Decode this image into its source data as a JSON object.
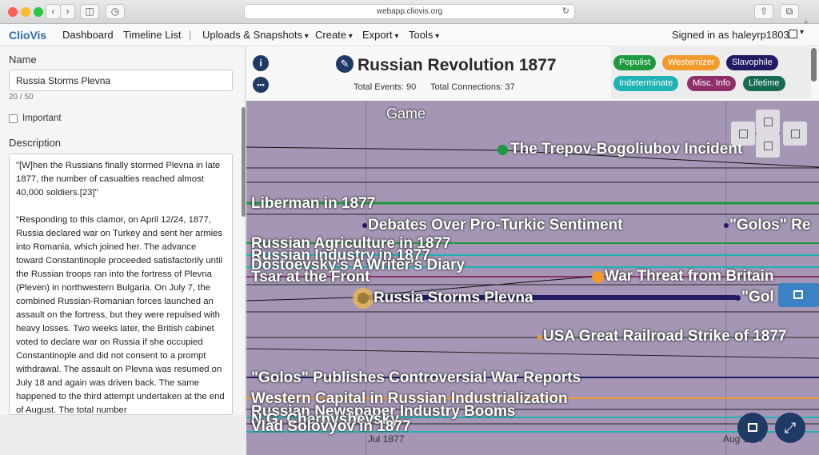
{
  "browser": {
    "url": "webapp.cliovis.org"
  },
  "nav": {
    "brand": "ClioVis",
    "dashboard": "Dashboard",
    "timeline_list": "Timeline List",
    "separator": "|",
    "uploads": "Uploads & Snapshots",
    "create": "Create",
    "export": "Export",
    "tools": "Tools",
    "signed_in": "Signed in as haleyrp1803"
  },
  "editor": {
    "name_label": "Name",
    "name_value": "Russia Storms Plevna",
    "name_counter": "20 / 50",
    "important_label": "Important",
    "description_label": "Description",
    "description": "\"[W]hen the Russians finally stormed Plevna in late 1877, the number of casualties reached almost 40,000 soldiers.[23]\"\n\n\"Responding to this clamor, on April 12/24, 1877, Russia declared war on Turkey and sent her armies into Romania, which joined her. The advance toward Constantinople proceeded satisfactorily until the Russian troops ran into the fortress of Plevna (Pleven) in northwestern Bulgaria. On July 7, the combined Russian-Romanian forces launched an assault on the fortress, but they were repulsed with heavy losses. Two weeks later, the British cabinet voted to declare war on Russia if she occupied Constantinople and did not consent to a prompt withdrawal. The assault on Plevna was resumed on July 18 and again was driven back. The same happened to the third attempt undertaken at the end of August. The total number"
  },
  "header": {
    "title": "Russian Revolution 1877",
    "total_events": "Total Events: 90",
    "total_connections": "Total Connections: 37"
  },
  "legend": [
    {
      "label": "Populist",
      "color": "#1e9a3e"
    },
    {
      "label": "Westernizer",
      "color": "#f29b2c"
    },
    {
      "label": "Slavophile",
      "color": "#221a63"
    },
    {
      "label": "Indeterminate",
      "color": "#1fb3b3"
    },
    {
      "label": "Misc. Info",
      "color": "#8f2f6a"
    },
    {
      "label": "Lifetime",
      "color": "#176b55"
    }
  ],
  "timeline": {
    "group_label": "Game",
    "events": [
      "The Trepov-Bogoliubov Incident",
      "Liberman in 1877",
      "Debates Over Pro-Turkic Sentiment",
      "\"Golos\" Re",
      "Russian Agriculture in 1877",
      "Russian Industry in 1877",
      "Dostoevsky's A Writer's Diary",
      "Tsar at the Front",
      "War Threat from Britain",
      "Russia Storms Plevna",
      "\"Gol",
      "USA Great Railroad Strike of 1877",
      "\"Golos\" Publishes Controversial War Reports",
      "Western Capital in Russian Industrialization",
      "Russian Newspaper Industry Booms",
      "N.G. Chernyshevsky",
      "Vlad Solovyov in 1877"
    ],
    "axis": [
      "Jul 1877",
      "Aug 1877"
    ]
  }
}
